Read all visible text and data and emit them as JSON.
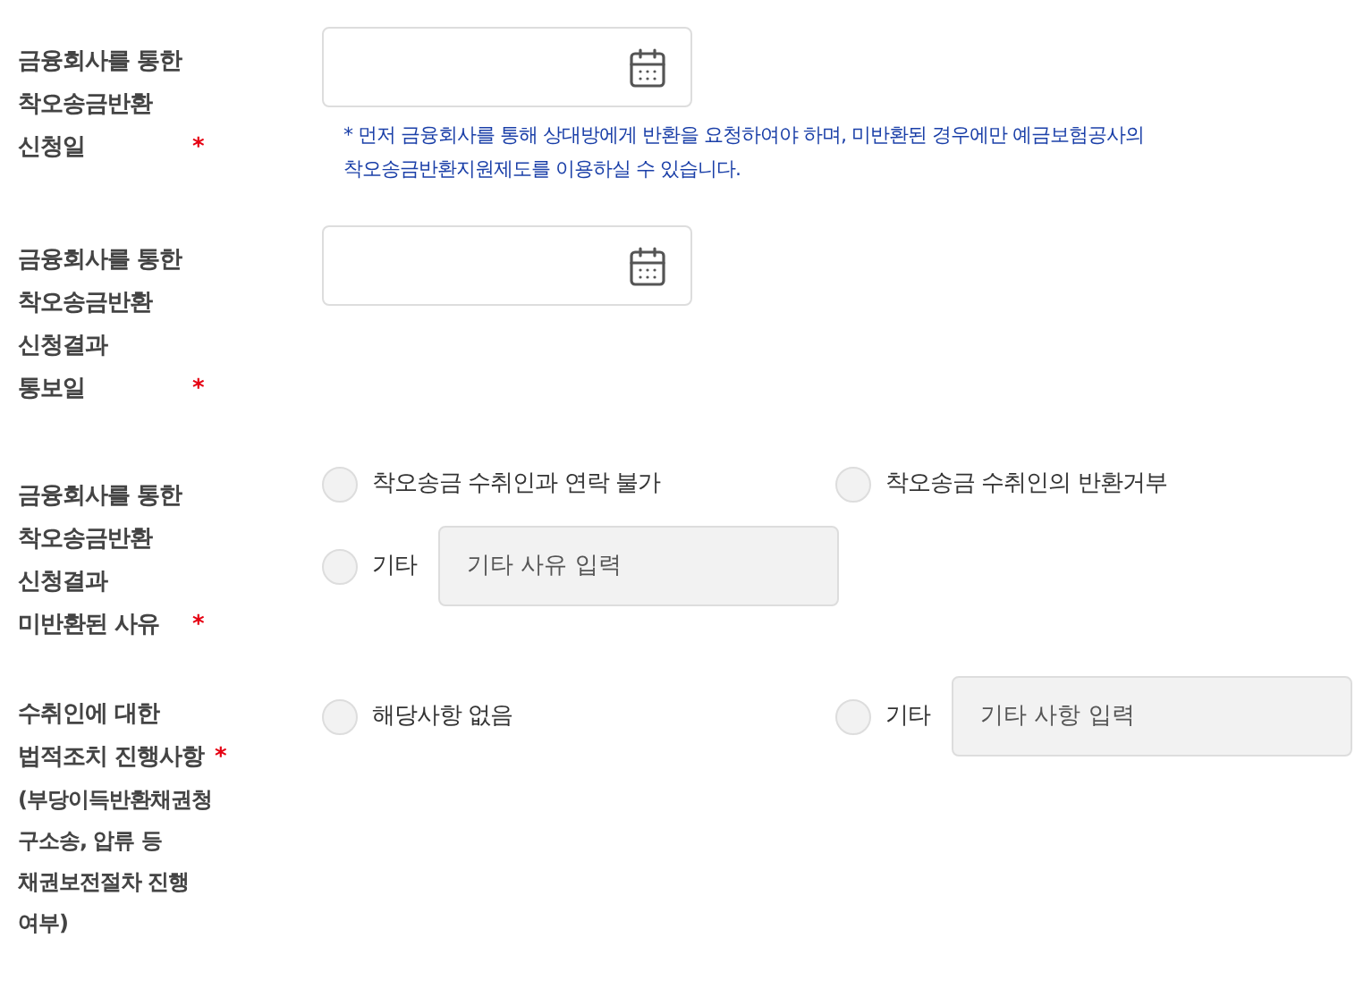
{
  "fields": [
    {
      "kind": "date",
      "label": "금융회사를 통한\n착오송금반환\n신청일",
      "required_mark": "*",
      "note": "* 먼저 금융회사를 통해 상대방에게 반환을 요청하여야 하며, 미반환된 경우에만 예금보험공사의\n착오송금반환지원제도를 이용하실 수 있습니다."
    },
    {
      "kind": "date",
      "label": "금융회사를 통한\n착오송금반환\n신청결과\n통보일",
      "required_mark": "*"
    },
    {
      "kind": "radio",
      "label": "금융회사를 통한\n착오송금반환\n신청결과\n미반환된 사유",
      "required_mark": "*",
      "options": [
        {
          "kind": "plain",
          "label": "착오송금 수취인과 연락 불가",
          "selected": false
        },
        {
          "kind": "plain",
          "label": "착오송금 수취인의 반환거부",
          "selected": false
        },
        {
          "kind": "other",
          "label": "기타",
          "selected": false,
          "placeholder": "기타 사유 입력"
        }
      ]
    },
    {
      "kind": "radio",
      "label": "수취인에 대한\n법적조치 진행사항",
      "required_mark": "*",
      "sub_label": "(부당이득반환채권청\n구소송, 압류 등\n채권보전절차 진행\n여부)",
      "options": [
        {
          "kind": "plain",
          "label": "해당사항 없음",
          "selected": false
        },
        {
          "kind": "other",
          "label": "기타",
          "selected": false,
          "placeholder": "기타 사항 입력"
        }
      ]
    }
  ]
}
